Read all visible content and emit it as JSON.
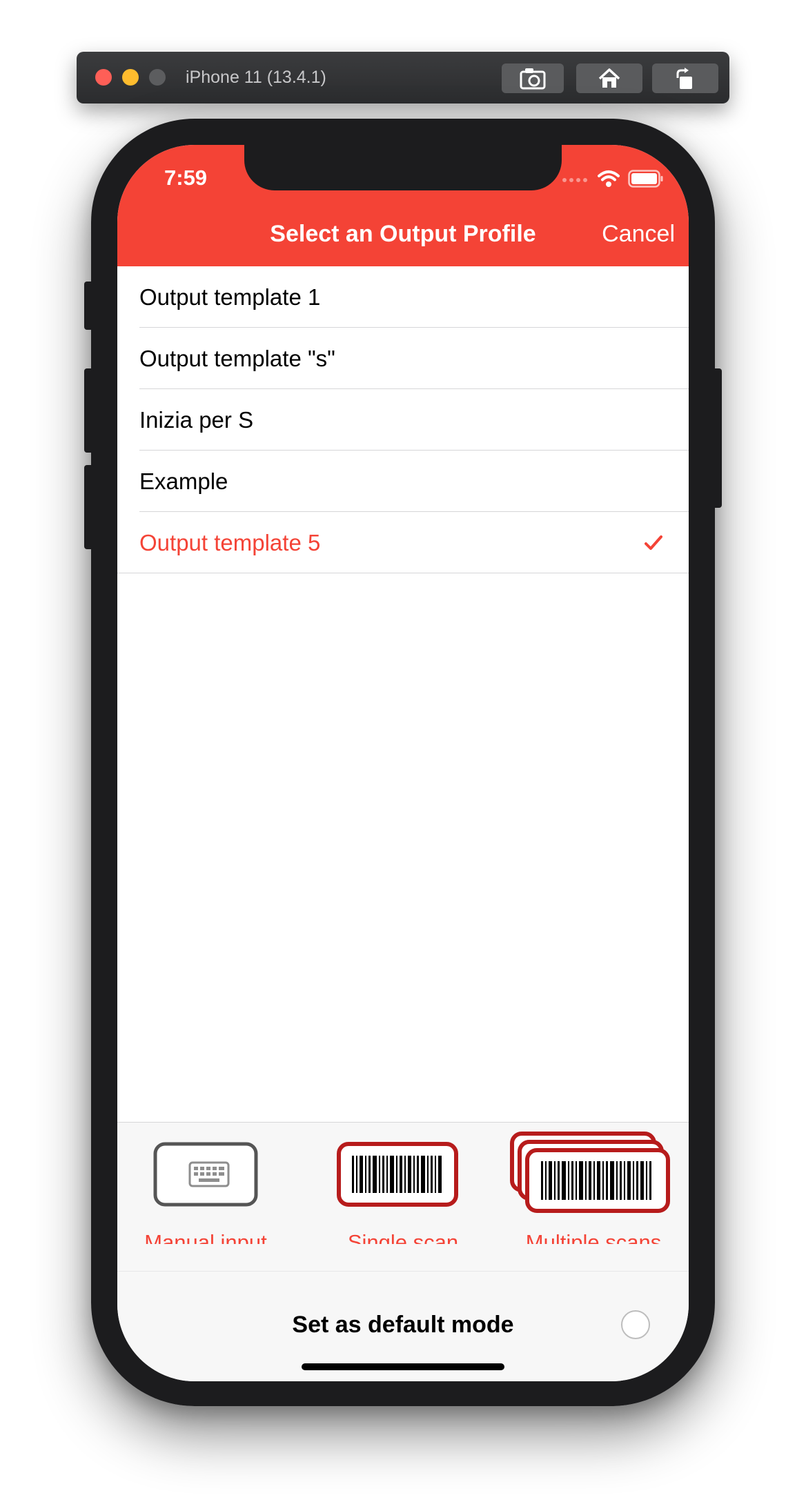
{
  "simulator": {
    "title": "iPhone 11 (13.4.1)",
    "buttons": [
      "screenshot-icon",
      "home-icon",
      "rotate-icon"
    ]
  },
  "status_bar": {
    "time": "7:59"
  },
  "nav": {
    "title": "Select an Output Profile",
    "cancel_label": "Cancel"
  },
  "colors": {
    "accent": "#f44336",
    "dark_red": "#b71c1c"
  },
  "list": {
    "items": [
      {
        "label": "Output template 1",
        "selected": false
      },
      {
        "label": "Output template \"s\"",
        "selected": false
      },
      {
        "label": "Inizia per S",
        "selected": false
      },
      {
        "label": "Example",
        "selected": false
      },
      {
        "label": "Output template 5",
        "selected": true
      }
    ]
  },
  "modes": {
    "manual_label": "Manual input",
    "single_label": "Single scan",
    "multiple_label": "Multiple scans"
  },
  "footer": {
    "label": "Set as default mode",
    "checked": false
  }
}
